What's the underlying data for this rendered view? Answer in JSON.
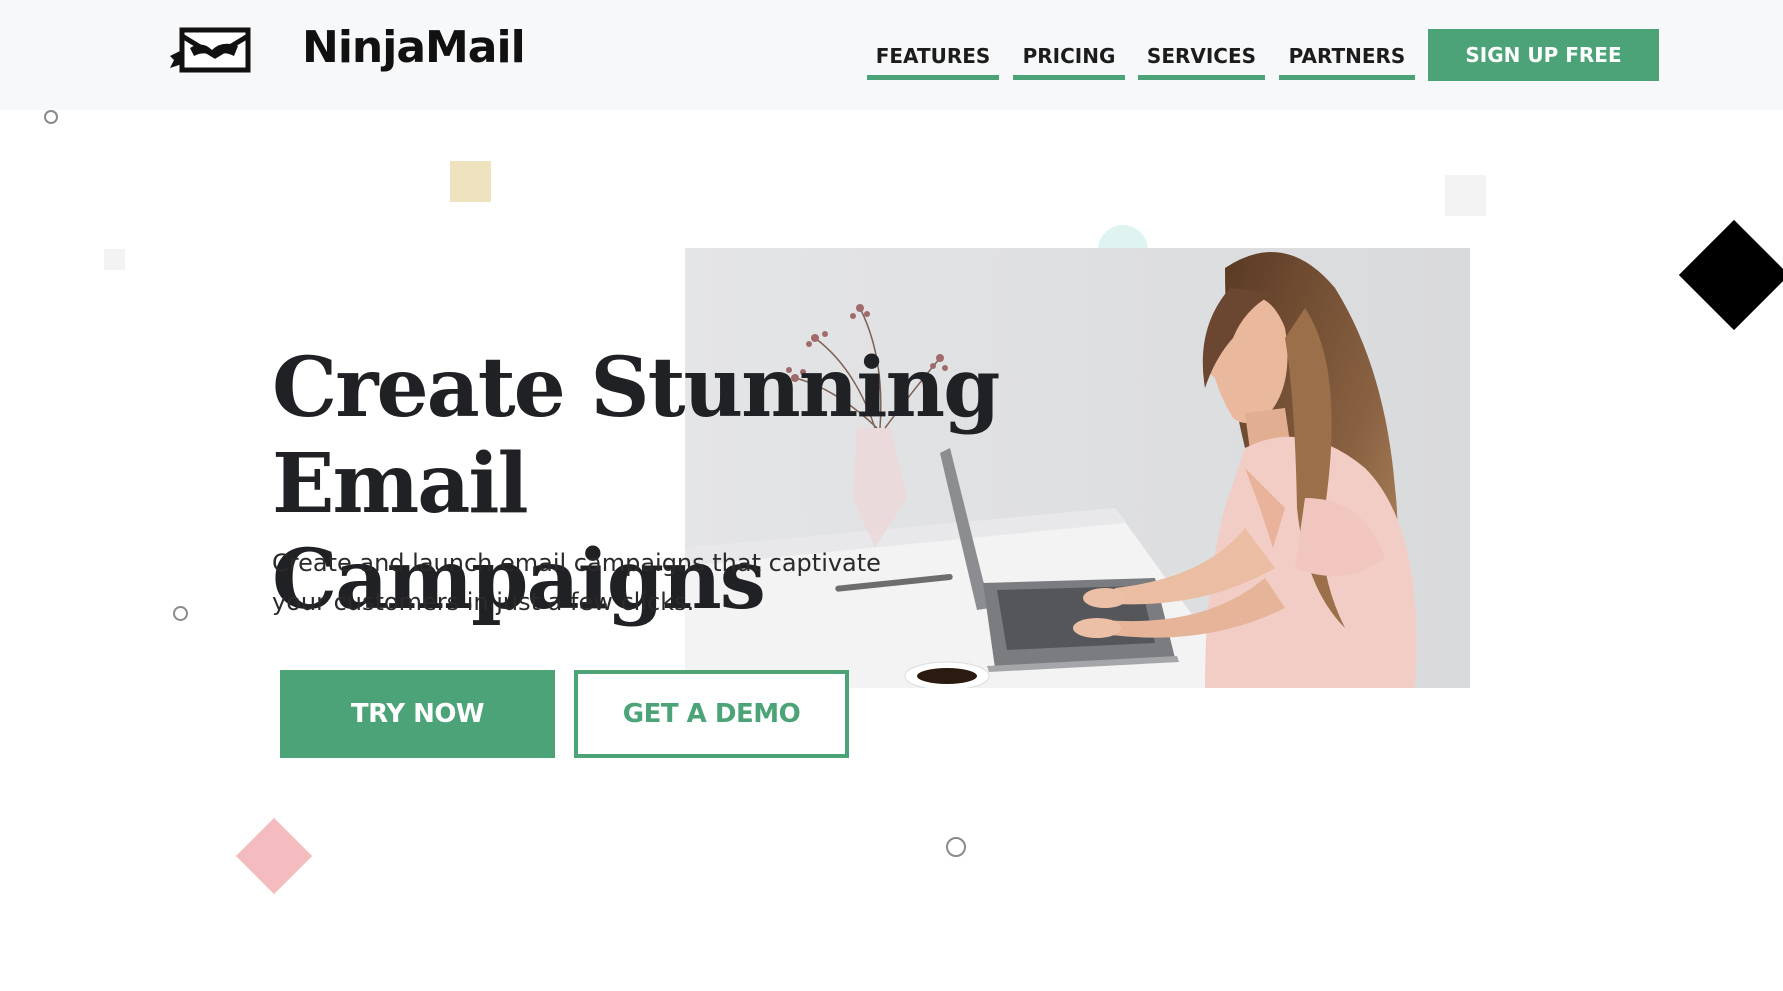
{
  "header": {
    "brand": "NinjaMail",
    "logo_icon": "ninja-envelope-icon",
    "nav": [
      {
        "label": "FEATURES"
      },
      {
        "label": "PRICING"
      },
      {
        "label": "SERVICES"
      },
      {
        "label": "PARTNERS"
      }
    ],
    "cta_label": "SIGN UP FREE"
  },
  "hero": {
    "title_line1": "Create Stunning",
    "title_line2": "Email Campaigns",
    "subtitle_line1": "Create and launch email campaigns that captivate",
    "subtitle_line2": "your customers in just a few clicks.",
    "primary_button": "TRY NOW",
    "secondary_button": "GET A DEMO",
    "image_subject": "woman-typing-on-laptop-photo"
  },
  "colors": {
    "accent": "#4ba377",
    "header_bg": "#f7f8f9",
    "text_dark": "#202124",
    "deco_tan": "#efe3bf",
    "deco_pink": "#f4bcbe",
    "deco_mint": "#dff3f0",
    "deco_black": "#000000"
  }
}
